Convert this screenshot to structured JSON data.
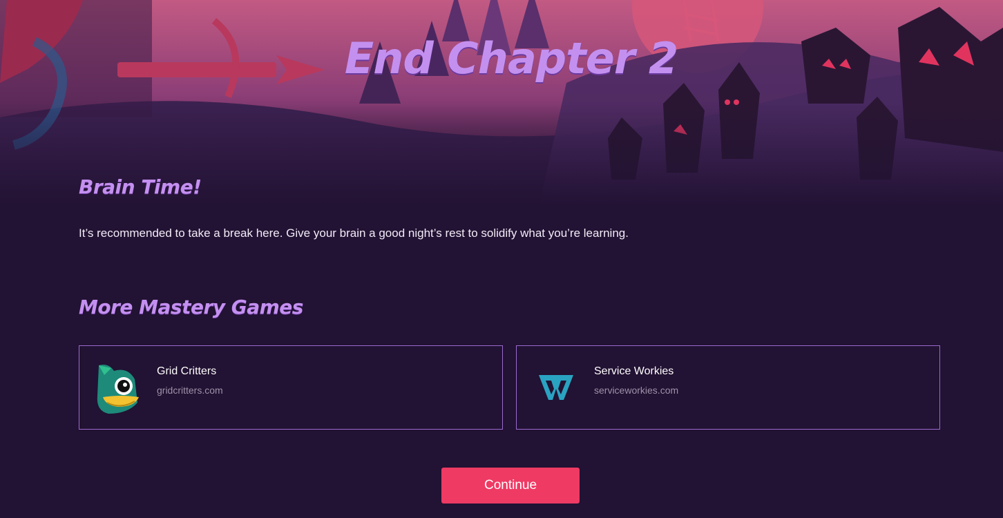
{
  "header": {
    "title": "End Chapter 2"
  },
  "brain": {
    "heading": "Brain Time!",
    "text": "It’s recommended to take a break here. Give your brain a good night’s rest to solidify what you’re learning."
  },
  "more_games": {
    "heading": "More Mastery Games",
    "items": [
      {
        "name": "Grid Critters",
        "url": "gridcritters.com",
        "icon": "grid-critters-logo"
      },
      {
        "name": "Service Workies",
        "url": "serviceworkies.com",
        "icon": "service-workies-logo"
      }
    ]
  },
  "actions": {
    "continue_label": "Continue"
  },
  "colors": {
    "background": "#221233",
    "heading": "#c490f0",
    "card_border": "#9b6bd0",
    "button": "#ef3a64",
    "muted_text": "#9d93aa"
  }
}
